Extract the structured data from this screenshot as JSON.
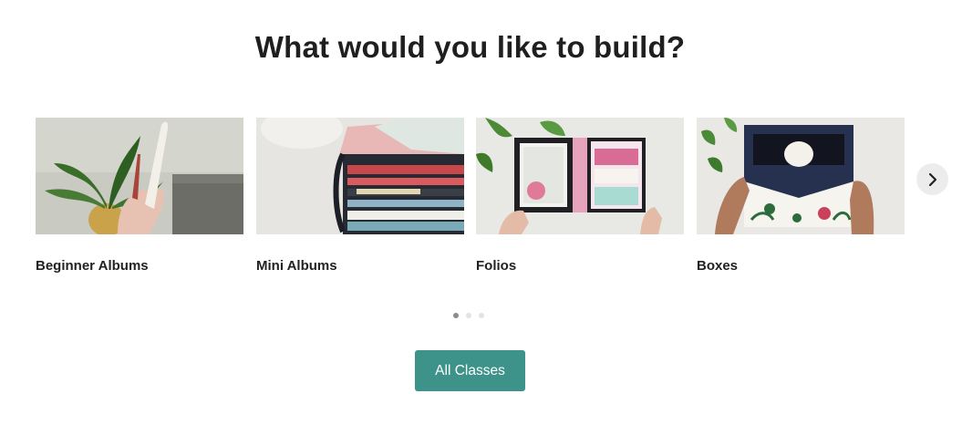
{
  "heading": "What would you like to build?",
  "cards": [
    {
      "label": "Beginner Albums"
    },
    {
      "label": "Mini Albums"
    },
    {
      "label": "Folios"
    },
    {
      "label": "Boxes"
    }
  ],
  "carousel": {
    "next_icon": "chevron-right-icon",
    "page_count": 3,
    "active_page": 1
  },
  "cta": {
    "label": "All Classes",
    "color": "#3d9289"
  }
}
